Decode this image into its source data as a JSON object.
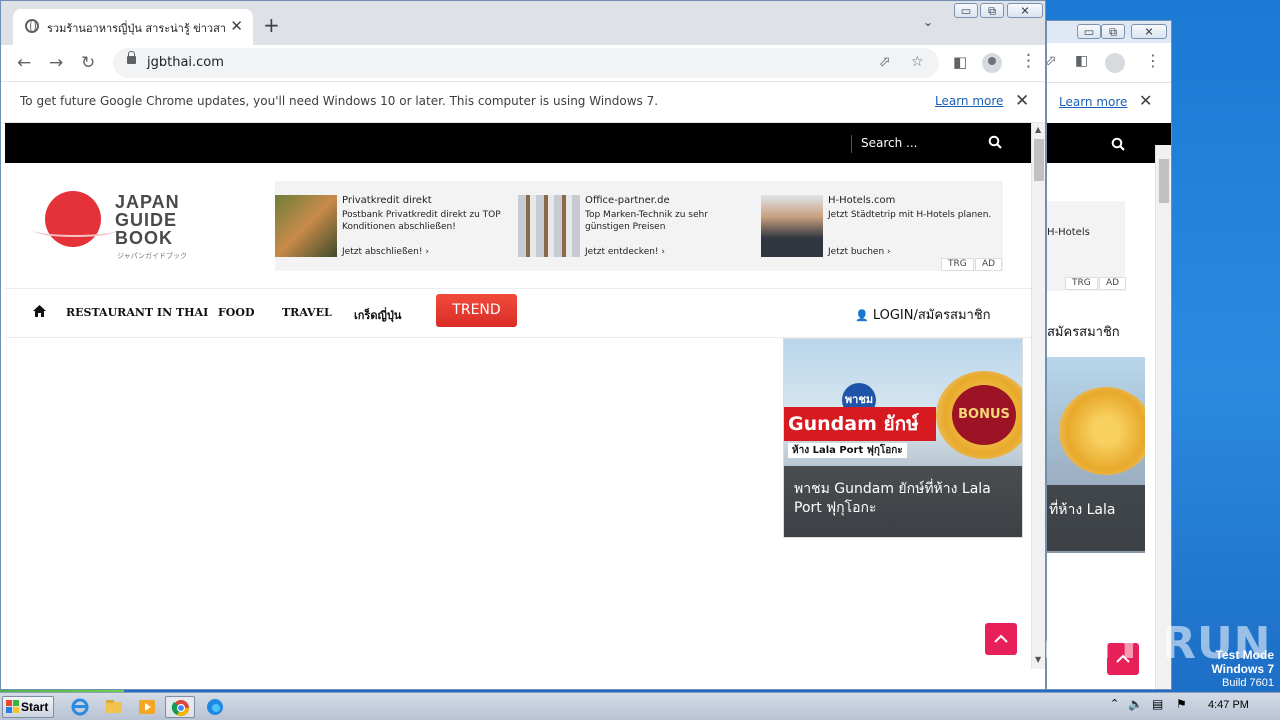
{
  "browser": {
    "tab_title": "รวมร้านอาหารญี่ปุ่น สาระน่ารู้ ข่าวสาร ญี่",
    "url": "jgbthai.com",
    "infobar_text": "To get future Google Chrome updates, you'll need Windows 10 or later. This computer is using Windows 7.",
    "learn_more": "Learn more"
  },
  "site": {
    "search_placeholder": "Search ...",
    "logo_words": [
      "JAPAN",
      "GUIDE",
      "BOOK"
    ],
    "logo_kana": "ジャパンガイドブック",
    "ads": [
      {
        "brand": "Privatkredit direkt",
        "desc": "Postbank Privatkredit direkt zu TOP Konditionen abschließen!",
        "cta": "Jetzt abschließen!  ›"
      },
      {
        "brand": "Office-partner.de",
        "desc": "Top Marken-Technik zu sehr günstigen Preisen",
        "cta": "Jetzt entdecken!  ›"
      },
      {
        "brand": "H-Hotels.com",
        "desc": "Jetzt Städtetrip mit H-Hotels planen.",
        "cta": "Jetzt buchen  ›"
      }
    ],
    "ad_tags": [
      "TRG",
      "AD"
    ],
    "nav": [
      "RESTAURANT IN THAI",
      "FOOD",
      "TRAVEL",
      "เกร็ดญี่ปุ่น"
    ],
    "trend": "TREND",
    "login": "LOGIN/สมัครสมาชิก",
    "feature": {
      "pin": "พาชม",
      "headline": "Gundam ยักษ์",
      "sub": "ห้าง Lala Port ฟุกุโอกะ",
      "bonus": "BONUS",
      "caption": "พาชม Gundam ยักษ์ที่ห้าง Lala Port ฟุกุโอกะ"
    }
  },
  "bg_window": {
    "learn_more": "Learn more",
    "ad_fragment": "H-Hotels",
    "ad_tags": [
      "TRG",
      "AD"
    ],
    "login_fragment": "สมัครสมาชิก",
    "caption_fragment": "ที่ห้าง Lala"
  },
  "desktop": {
    "watermark": "ANY RUN",
    "test_mode": [
      "Test Mode",
      "Windows 7",
      "Build 7601"
    ]
  },
  "taskbar": {
    "start": "Start",
    "clock": "4:47 PM"
  },
  "colors": {
    "accent_red": "#e53238",
    "trend_red": "#e53a30",
    "to_top_pink": "#e8205a",
    "chrome_link": "#1a5fb4"
  }
}
